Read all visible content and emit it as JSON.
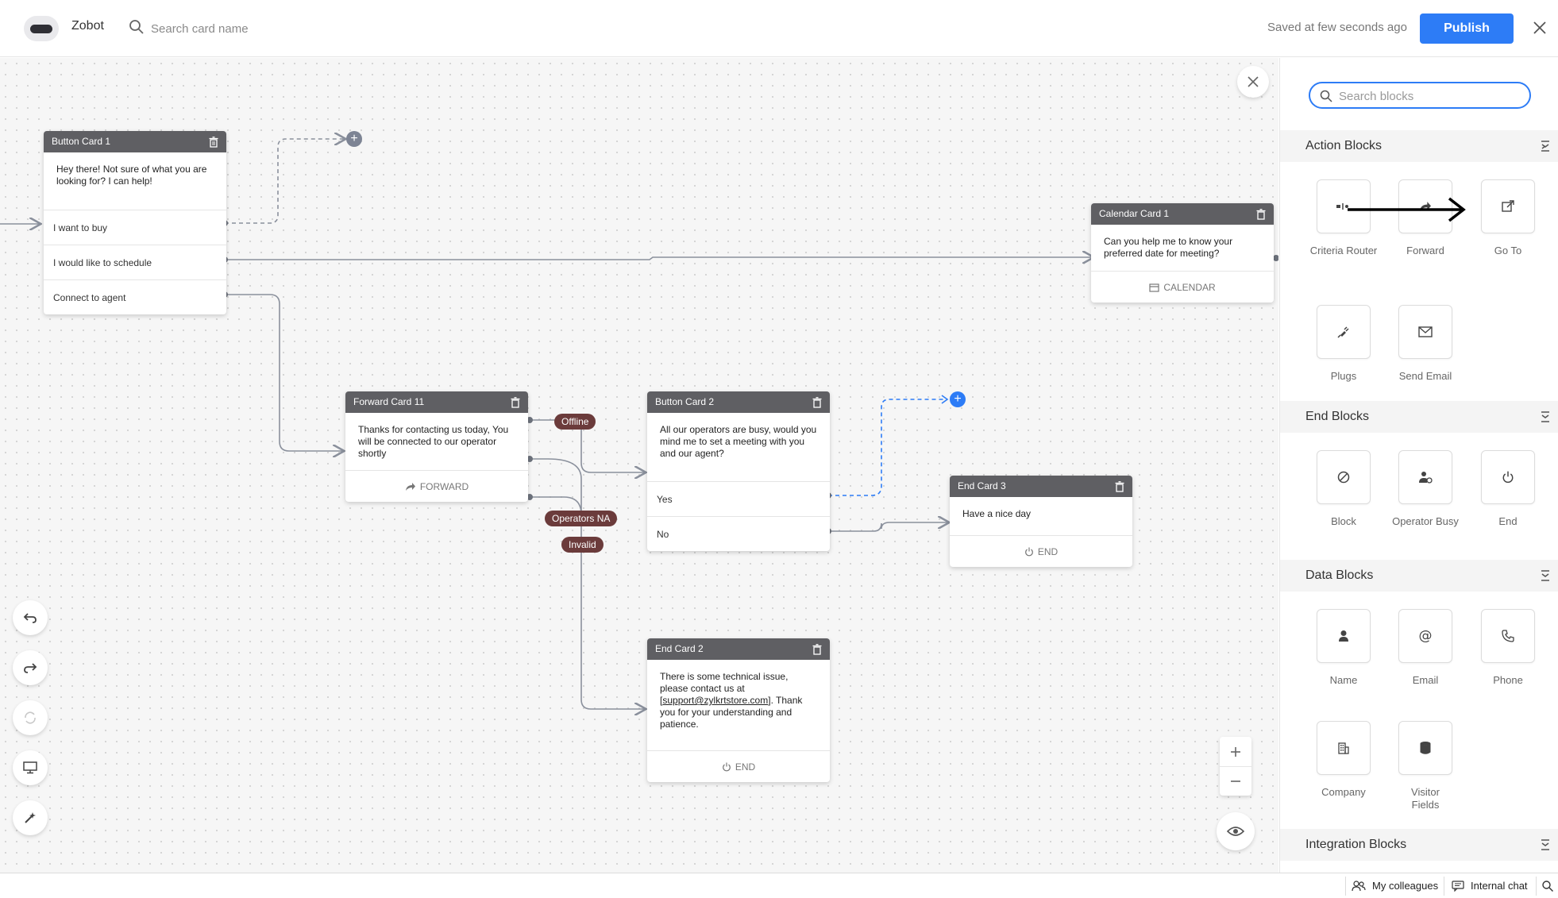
{
  "app": {
    "name": "Zobot"
  },
  "header": {
    "search_placeholder": "Search card name",
    "saved_status": "Saved at few seconds ago",
    "publish_label": "Publish"
  },
  "cards": {
    "button_card_1": {
      "title": "Button Card 1",
      "message": "Hey there! Not sure of what you are looking for? I can help!",
      "options": [
        "I want to buy",
        "I would like to schedule",
        "Connect to agent"
      ]
    },
    "calendar_card_1": {
      "title": "Calendar Card 1",
      "message": "Can you help me to know your preferred date for meeting?",
      "footer": "CALENDAR"
    },
    "forward_card_11": {
      "title": "Forward Card 11",
      "message": "Thanks for contacting us today, You will be connected to our operator shortly",
      "footer": "FORWARD"
    },
    "button_card_2": {
      "title": "Button Card 2",
      "message": "All our operators are busy, would you mind me to set a meeting with you and our agent?",
      "options": [
        "Yes",
        "No"
      ]
    },
    "end_card_3": {
      "title": "End Card 3",
      "message": "Have a nice day",
      "footer": "END"
    },
    "end_card_2": {
      "title": "End Card 2",
      "message_before": "There is some technical issue, please contact us at [",
      "message_link": "support@zylkrtstore.com",
      "message_after": "]. Thank you for your understanding and patience.",
      "footer": "END"
    }
  },
  "connector_labels": {
    "offline": "Offline",
    "operators_na": "Operators NA",
    "invalid": "Invalid"
  },
  "panel": {
    "search_placeholder": "Search blocks",
    "sections": {
      "action": {
        "title": "Action Blocks",
        "items": [
          {
            "label": "Criteria Router",
            "icon": "criteria-router-icon"
          },
          {
            "label": "Forward",
            "icon": "forward-icon"
          },
          {
            "label": "Go To",
            "icon": "go-to-icon"
          },
          {
            "label": "Plugs",
            "icon": "plug-icon"
          },
          {
            "label": "Send Email",
            "icon": "envelope-icon"
          }
        ]
      },
      "end": {
        "title": "End Blocks",
        "items": [
          {
            "label": "Block",
            "icon": "block-icon"
          },
          {
            "label": "Operator Busy",
            "icon": "operator-busy-icon"
          },
          {
            "label": "End",
            "icon": "power-icon"
          }
        ]
      },
      "data": {
        "title": "Data Blocks",
        "items": [
          {
            "label": "Name",
            "icon": "person-icon"
          },
          {
            "label": "Email",
            "icon": "at-icon"
          },
          {
            "label": "Phone",
            "icon": "phone-icon"
          },
          {
            "label": "Company",
            "icon": "building-icon"
          },
          {
            "label": "Visitor Fields",
            "icon": "database-icon"
          }
        ]
      },
      "integration": {
        "title": "Integration Blocks"
      }
    }
  },
  "bottom_bar": {
    "colleagues": "My colleagues",
    "internal_chat": "Internal chat"
  },
  "colors": {
    "accent": "#2d7cf6",
    "card_header": "#5f5f63",
    "connector_pill": "#6b3b3b",
    "link_line": "#8a909c"
  }
}
